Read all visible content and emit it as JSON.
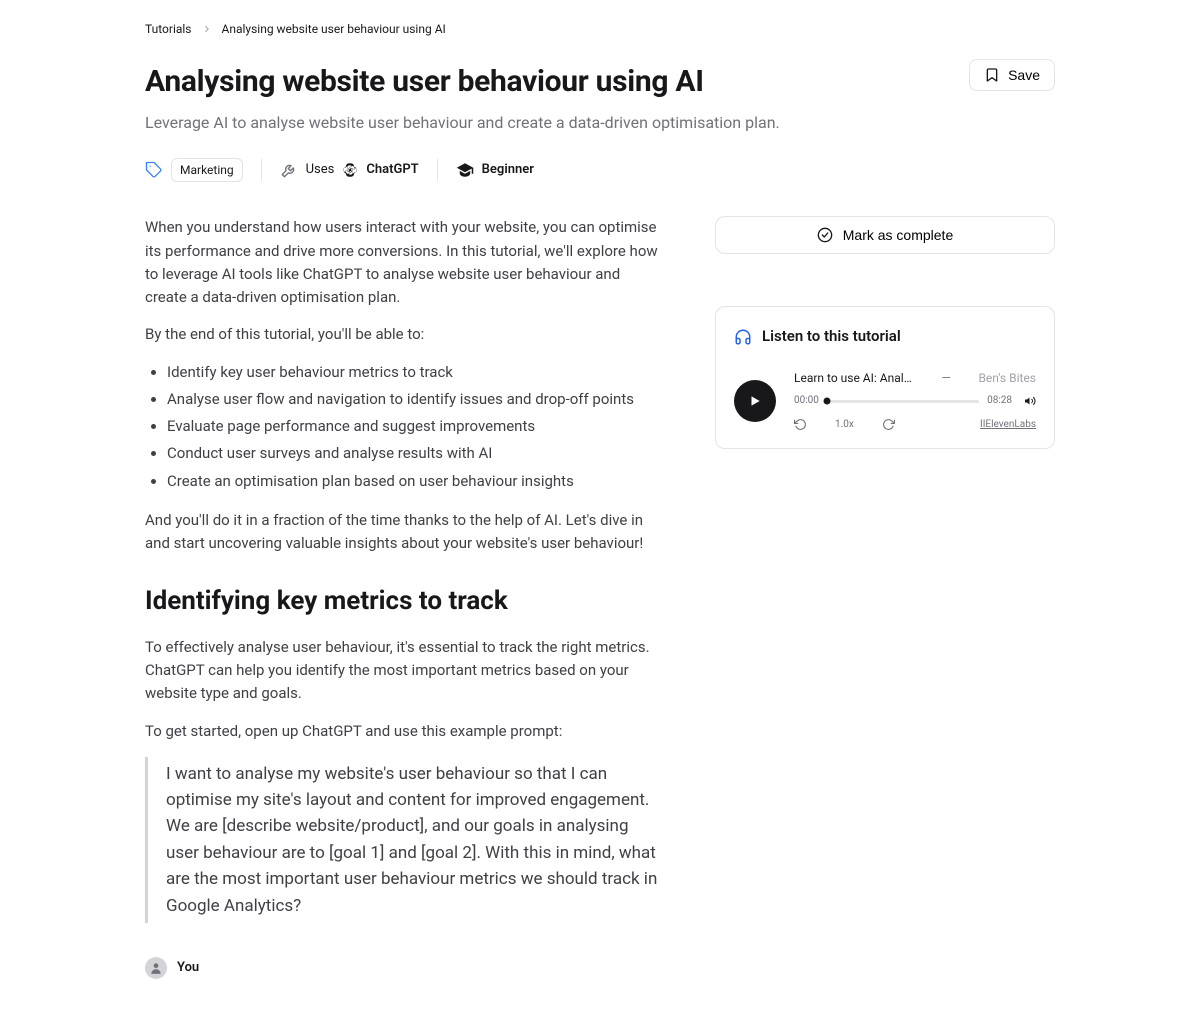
{
  "breadcrumb": {
    "root": "Tutorials",
    "current": "Analysing website user behaviour using AI"
  },
  "header": {
    "title": "Analysing website user behaviour using AI",
    "subtitle": "Leverage AI to analyse website user behaviour and create a data-driven optimisation plan.",
    "save_label": "Save"
  },
  "meta": {
    "tag": "Marketing",
    "uses_label": "Uses",
    "tool": "ChatGPT",
    "level": "Beginner"
  },
  "article": {
    "intro": "When you understand how users interact with your website, you can optimise its performance and drive more conversions. In this tutorial, we'll explore how to leverage AI tools like ChatGPT to analyse website user behaviour and create a data-driven optimisation plan.",
    "lead": "By the end of this tutorial, you'll be able to:",
    "bullets": [
      "Identify key user behaviour metrics to track",
      "Analyse user flow and navigation to identify issues and drop-off points",
      "Evaluate page performance and suggest improvements",
      "Conduct user surveys and analyse results with AI",
      "Create an optimisation plan based on user behaviour insights"
    ],
    "outro": "And you'll do it in a fraction of the time thanks to the help of AI. Let's dive in and start uncovering valuable insights about your website's user behaviour!",
    "h2": "Identifying key metrics to track",
    "p2": "To effectively analyse user behaviour, it's essential to track the right metrics. ChatGPT can help you identify the most important metrics based on your website type and goals.",
    "p3": "To get started, open up ChatGPT and use this example prompt:",
    "quote": "I want to analyse my website's user behaviour so that I can optimise my site's layout and content for improved engagement. We are [describe website/product], and our goals in analysing user behaviour are to [goal 1] and [goal 2]. With this in mind, what are the most important user behaviour metrics we should track in Google Analytics?",
    "chat_name": "You"
  },
  "rail": {
    "complete_label": "Mark as complete",
    "listen_label": "Listen to this tutorial",
    "player": {
      "title": "Learn to use AI: Analys…",
      "author": "Ben's Bites",
      "current_time": "00:00",
      "duration": "08:28",
      "speed": "1.0x",
      "provider": "IIElevenLabs"
    }
  }
}
